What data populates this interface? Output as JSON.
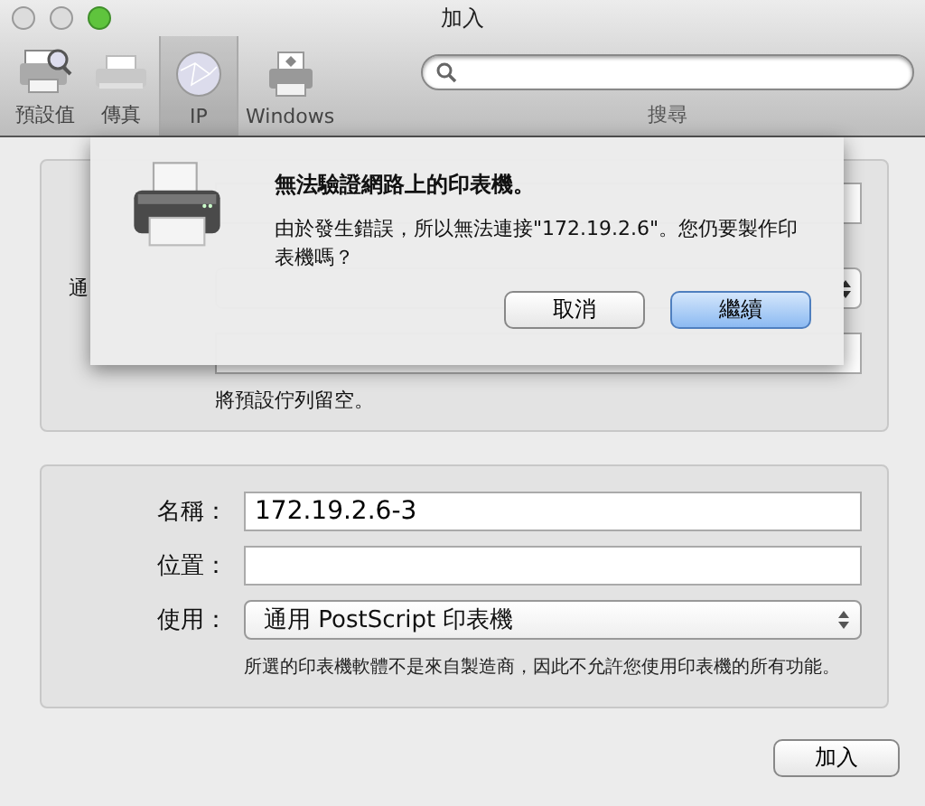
{
  "window": {
    "title": "加入"
  },
  "toolbar": {
    "items": [
      {
        "label": "預設值",
        "kind": "printer-search",
        "selected": false
      },
      {
        "label": "傳真",
        "kind": "fax",
        "selected": false
      },
      {
        "label": "IP",
        "kind": "globe",
        "selected": true
      },
      {
        "label": "Windows",
        "kind": "windows-printer",
        "selected": false
      }
    ],
    "search": {
      "label": "搜尋"
    }
  },
  "upper_panel": {
    "protocol_label": "通",
    "hint": "將預設佇列留空。"
  },
  "lower_panel": {
    "fields": [
      {
        "kind": "text",
        "label": "名稱：",
        "value": "172.19.2.6-3"
      },
      {
        "kind": "text",
        "label": "位置："
      },
      {
        "kind": "select",
        "label": "使用：",
        "value": "通用 PostScript 印表機"
      }
    ],
    "note": "所選的印表機軟體不是來自製造商，因此不允許您使用印表機的所有功能。"
  },
  "sheet": {
    "title": "無法驗證網路上的印表機。",
    "message": "由於發生錯誤，所以無法連接\"172.19.2.6\"。您仍要製作印表機嗎？",
    "buttons": [
      {
        "label": "取消",
        "default": false
      },
      {
        "label": "繼續",
        "default": true
      }
    ]
  },
  "add_button": "加入"
}
